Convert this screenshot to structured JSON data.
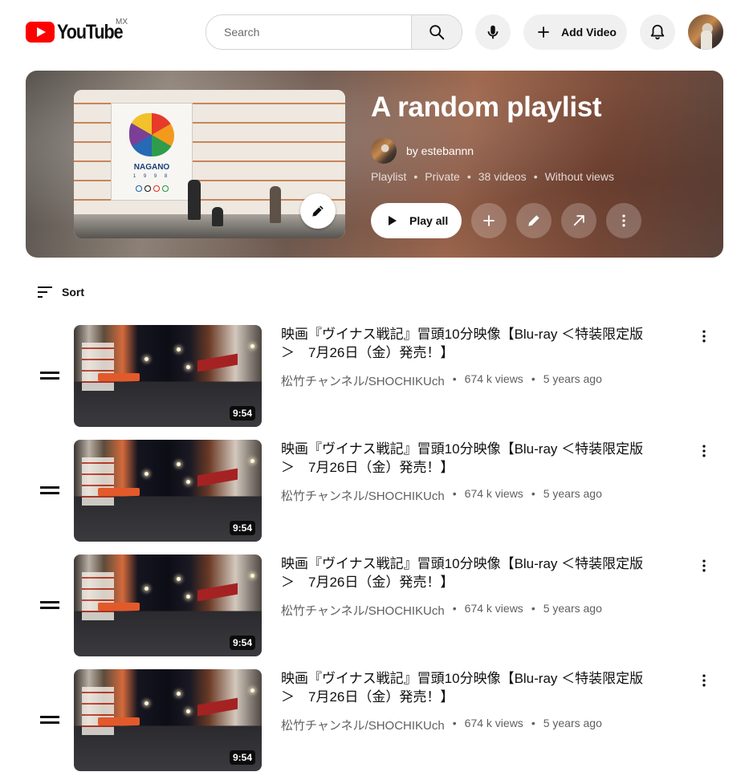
{
  "header": {
    "logo_text": "YouTube",
    "region": "MX",
    "search_placeholder": "Search",
    "add_video_label": "Add Video"
  },
  "playlist": {
    "title": "A random playlist",
    "owner": "by estebannn",
    "meta": [
      "Playlist",
      "Private",
      "38 videos",
      "Without views"
    ],
    "poster_text": "NAGANO",
    "poster_year": "1 9 9 8",
    "play_all_label": "Play all"
  },
  "sort_label": "Sort",
  "videos": [
    {
      "title": "映画『ヴイナス戦記』冒頭10分映像【Blu-ray ＜特装限定版＞　7月26日（金）発売！】",
      "channel": "松竹チャンネル/SHOCHIKUch",
      "views": "674 k views",
      "age": "5 years ago",
      "duration": "9:54"
    },
    {
      "title": "映画『ヴイナス戦記』冒頭10分映像【Blu-ray ＜特装限定版＞　7月26日（金）発売！】",
      "channel": "松竹チャンネル/SHOCHIKUch",
      "views": "674 k views",
      "age": "5 years ago",
      "duration": "9:54"
    },
    {
      "title": "映画『ヴイナス戦記』冒頭10分映像【Blu-ray ＜特装限定版＞　7月26日（金）発売！】",
      "channel": "松竹チャンネル/SHOCHIKUch",
      "views": "674 k views",
      "age": "5 years ago",
      "duration": "9:54"
    },
    {
      "title": "映画『ヴイナス戦記』冒頭10分映像【Blu-ray ＜特装限定版＞　7月26日（金）発売！】",
      "channel": "松竹チャンネル/SHOCHIKUch",
      "views": "674 k views",
      "age": "5 years ago",
      "duration": "9:54"
    }
  ],
  "colors": {
    "brand": "#ff0000",
    "chip_bg": "#f0f0f0",
    "meta_text": "#606060"
  }
}
